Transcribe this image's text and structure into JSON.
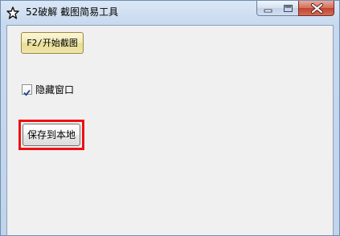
{
  "window": {
    "title": "52破解 截图简易工具",
    "app_icon": "star-icon",
    "controls": {
      "minimize_icon": "minimize-icon",
      "maximize_icon": "maximize-icon",
      "close_icon": "close-icon"
    }
  },
  "main": {
    "capture_button_label": "F2/开始截图",
    "hide_window_checkbox": {
      "label": "隐藏窗口",
      "checked": true
    },
    "save_button_label": "保存到本地",
    "highlight_color": "#ee1111"
  }
}
